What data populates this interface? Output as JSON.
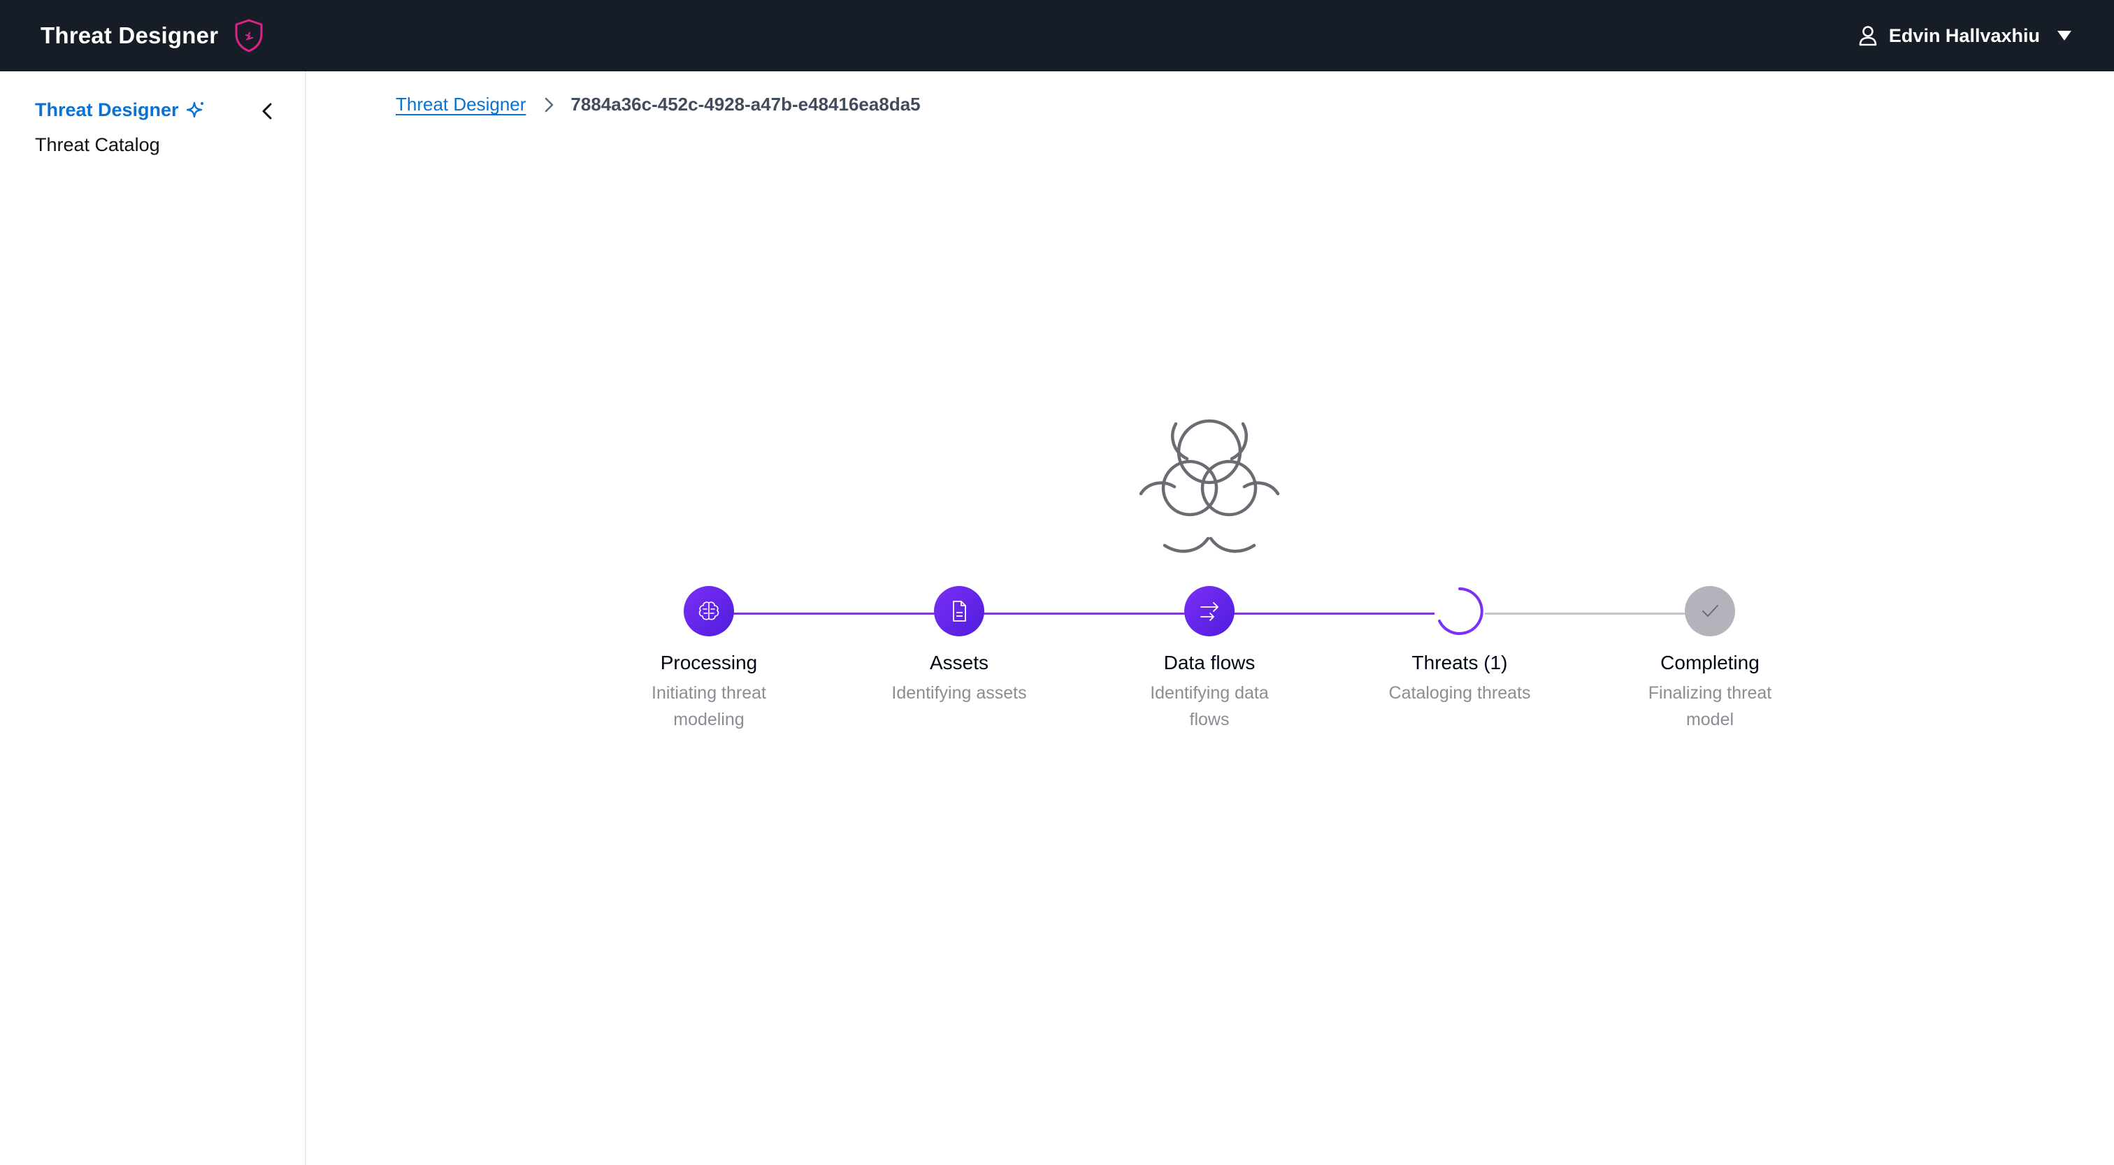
{
  "app": {
    "title": "Threat Designer",
    "colors": {
      "nav_bg": "#161d26",
      "accent": "#0972d3",
      "progress": "#7d3ad9",
      "logo": "#e0218a"
    }
  },
  "user": {
    "name": "Edvin Hallvaxhiu"
  },
  "sidebar": {
    "items": [
      {
        "label": "Threat Designer",
        "active": true,
        "icon": "sparkle-icon"
      },
      {
        "label": "Threat Catalog",
        "active": false
      }
    ]
  },
  "breadcrumb": {
    "root": "Threat Designer",
    "current": "7884a36c-452c-4928-a47b-e48416ea8da5"
  },
  "progress": {
    "hero_icon": "biohazard-icon",
    "steps": [
      {
        "title": "Processing",
        "subtitle": "Initiating threat modeling",
        "status": "done",
        "icon": "brain-icon"
      },
      {
        "title": "Assets",
        "subtitle": "Identifying assets",
        "status": "done",
        "icon": "document-icon"
      },
      {
        "title": "Data flows",
        "subtitle": "Identifying data flows",
        "status": "done",
        "icon": "arrows-icon"
      },
      {
        "title": "Threats (1)",
        "subtitle": "Cataloging threats",
        "status": "in-progress",
        "icon": "spinner-icon"
      },
      {
        "title": "Completing",
        "subtitle": "Finalizing threat model",
        "status": "pending",
        "icon": "check-icon"
      }
    ]
  }
}
